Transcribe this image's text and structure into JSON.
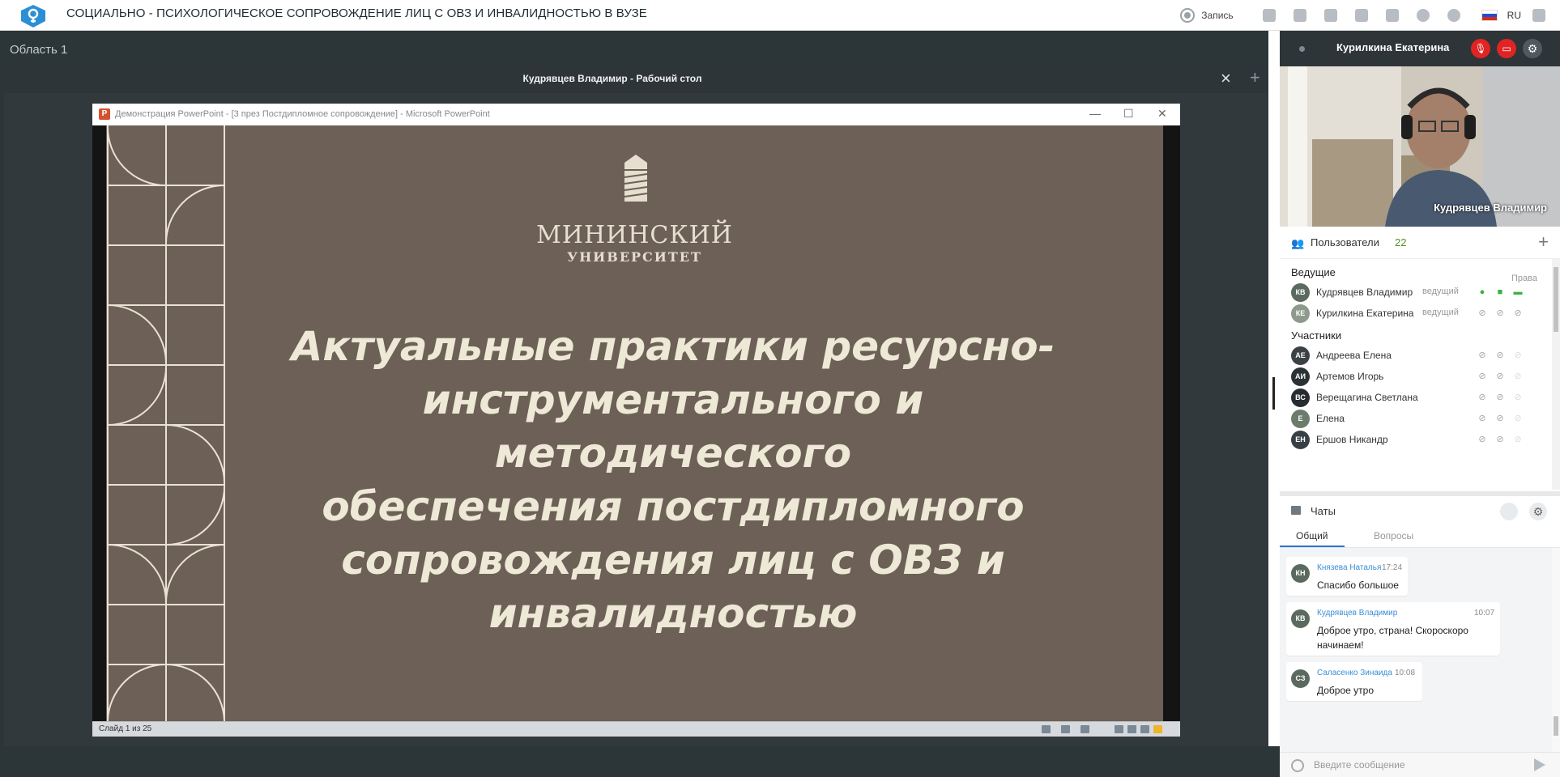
{
  "app": {
    "title": "СОЦИАЛЬНО - ПСИХОЛОГИЧЕСКОЕ СОПРОВОЖДЕНИЕ ЛИЦ С ОВЗ И ИНВАЛИДНОСТЬЮ В ВУЗЕ",
    "record_label": "Запись",
    "language": "RU",
    "accent_color": "#2c8fd6"
  },
  "area": {
    "label": "Область 1"
  },
  "shared_window": {
    "title": "Кудрявцев Владимир - Рабочий стол",
    "close_icon": "×",
    "add_icon": "+"
  },
  "powerpoint": {
    "icon_letter": "P",
    "title": "Демонстрация PowerPoint - [3 през Постдипломное сопровождение] - Microsoft PowerPoint",
    "minimize": "—",
    "maximize": "☐",
    "close": "✕",
    "status": "Слайд 1 из 25"
  },
  "slide": {
    "university_line1": "МИНИНСКИЙ",
    "university_line2": "УНИВЕРСИТЕТ",
    "title_lines": [
      "Актуальные практики ресурсно-",
      "инструментального и методического",
      "обеспечения постдипломного",
      "сопровождения лиц с ОВЗ и",
      "инвалидностью"
    ]
  },
  "self_view": {
    "name": "Курилкина Екатерина",
    "mic_icon": "mic-off-icon",
    "cam_icon": "camera-off-icon",
    "settings_icon": "gear-icon"
  },
  "video": {
    "speaker_name": "Кудрявцев Владимир"
  },
  "users": {
    "title": "Пользователи",
    "count": "22",
    "hosts_label": "Ведущие",
    "rights_label": "Права",
    "participants_label": "Участники",
    "hosts": [
      {
        "initials": "КВ",
        "name": "Кудрявцев Владимир",
        "role": "ведущий",
        "color": "#5b6a5e",
        "active": true
      },
      {
        "initials": "КЕ",
        "name": "Курилкина Екатерина",
        "role": "ведущий",
        "color": "#8d9a8c",
        "active": false
      }
    ],
    "participants": [
      {
        "initials": "АЕ",
        "name": "Андреева Елена",
        "color": "#3b4246"
      },
      {
        "initials": "АИ",
        "name": "Артемов Игорь",
        "color": "#2b3236"
      },
      {
        "initials": "ВС",
        "name": "Верещагина Светлана",
        "color": "#262c30"
      },
      {
        "initials": "Е",
        "name": "Елена",
        "color": "#6b7c6d"
      },
      {
        "initials": "ЕН",
        "name": "Ершов Никандр",
        "color": "#394045"
      }
    ]
  },
  "chats": {
    "title": "Чаты",
    "tab_general": "Общий",
    "tab_questions": "Вопросы",
    "messages": [
      {
        "initials": "КН",
        "author": "Князева Наталья",
        "time": "17:24",
        "lines": [
          "Спасибо большое"
        ]
      },
      {
        "initials": "КВ",
        "author": "Кудрявцев Владимир",
        "time": "10:07",
        "lines": [
          "Доброе утро, страна! Скороскоро",
          "начинаем!"
        ]
      },
      {
        "initials": "СЗ",
        "author": "Саласенко Зинаида",
        "time": "10:08",
        "lines": [
          "Доброе утро"
        ]
      }
    ],
    "input_placeholder": "Введите сообщение"
  }
}
